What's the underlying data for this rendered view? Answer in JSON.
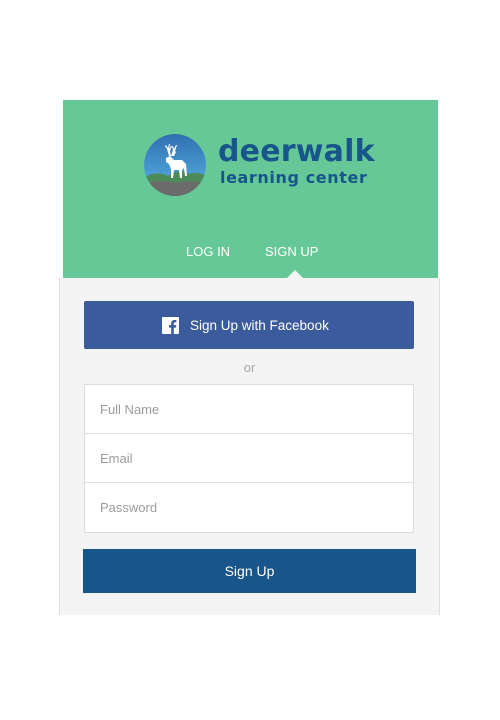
{
  "brand": {
    "name": "deerwalk",
    "tagline": "learning center",
    "logo_icon": "deer-logo-icon"
  },
  "tabs": {
    "login_label": "LOG IN",
    "signup_label": "SIGN UP",
    "active": "SIGN UP"
  },
  "facebook": {
    "label": "Sign Up with Facebook",
    "icon": "facebook-icon"
  },
  "separator": "or",
  "form": {
    "full_name_placeholder": "Full Name",
    "email_placeholder": "Email",
    "password_placeholder": "Password",
    "submit_label": "Sign Up"
  },
  "colors": {
    "header_green": "#66c896",
    "brand_blue": "#17558a",
    "facebook_blue": "#3b5b9d",
    "panel_gray": "#f4f4f4"
  }
}
